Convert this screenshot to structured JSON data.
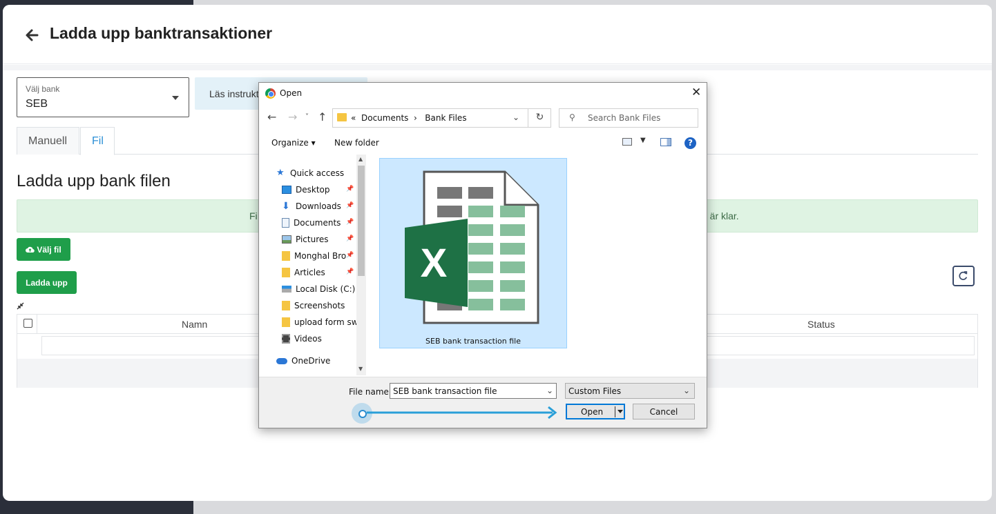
{
  "page": {
    "title": "Ladda upp banktransaktioner",
    "bank_select": {
      "label": "Välj bank",
      "value": "SEB"
    },
    "info_text": "Läs instrukt",
    "tabs": [
      {
        "label": "Manuell"
      },
      {
        "label": "Fil"
      }
    ],
    "section_title": "Ladda upp bank filen",
    "alert": {
      "left": "Fi",
      "right": "g är klar."
    },
    "choose_file_button": "Välj fil",
    "upload_button": "Ladda upp",
    "table": {
      "columns": [
        "Namn",
        "Status"
      ]
    }
  },
  "dialog": {
    "title": "Open",
    "path": {
      "prefix": "«",
      "items": [
        "Documents",
        "Bank Files"
      ]
    },
    "search_placeholder": "Search Bank Files",
    "toolbar": {
      "organize": "Organize",
      "new_folder": "New folder"
    },
    "nav_items": [
      {
        "label": "Quick access",
        "icon": "star-icon"
      },
      {
        "label": "Desktop",
        "icon": "desktop-icon"
      },
      {
        "label": "Downloads",
        "icon": "download-icon"
      },
      {
        "label": "Documents",
        "icon": "document-icon"
      },
      {
        "label": "Pictures",
        "icon": "picture-icon"
      },
      {
        "label": "Monghal Bro",
        "icon": "folder-icon"
      },
      {
        "label": "Articles",
        "icon": "folder-icon"
      },
      {
        "label": "Local Disk (C:)",
        "icon": "disk-icon"
      },
      {
        "label": "Screenshots",
        "icon": "folder-icon"
      },
      {
        "label": "upload form swe",
        "icon": "folder-icon"
      },
      {
        "label": "Videos",
        "icon": "video-icon"
      },
      {
        "label": "OneDrive",
        "icon": "cloud-icon"
      }
    ],
    "file": {
      "name": "SEB bank transaction file",
      "icon": "excel-icon"
    },
    "file_name_label": "File name:",
    "file_name_value": "SEB bank transaction file",
    "file_type": "Custom Files",
    "open_button": "Open",
    "cancel_button": "Cancel"
  },
  "colors": {
    "accent_blue": "#2c8fd6",
    "green": "#1f9e4a",
    "selection": "#cce8ff",
    "excel_green": "#1e7145"
  }
}
